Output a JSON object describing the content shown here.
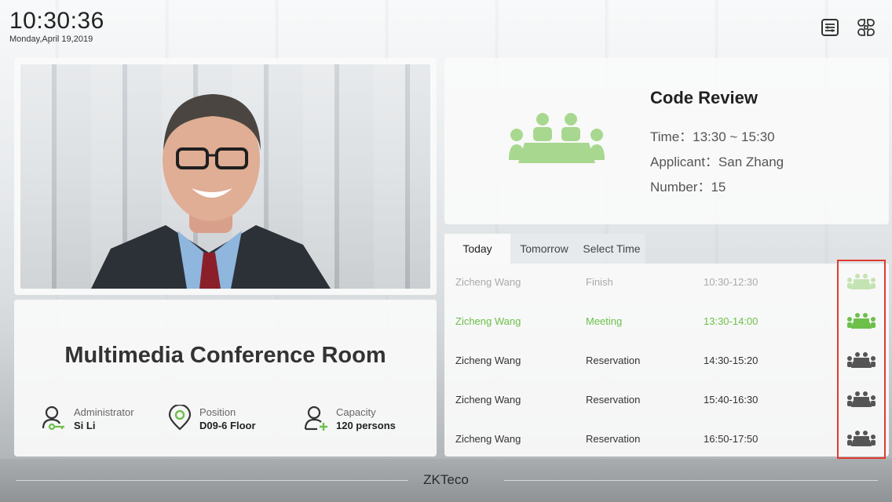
{
  "header": {
    "time": "10:30:36",
    "date": "Monday,April 19,2019",
    "icons": [
      "list-icon",
      "grid-icon"
    ]
  },
  "room": {
    "name": "Multimedia Conference Room",
    "administrator": {
      "label": "Administrator",
      "value": "Si Li",
      "icon": "admin-key-icon"
    },
    "position": {
      "label": "Position",
      "value": "D09-6 Floor",
      "icon": "location-pin-icon"
    },
    "capacity": {
      "label": "Capacity",
      "value": "120 persons",
      "icon": "person-add-icon"
    }
  },
  "meeting": {
    "title": "Code Review",
    "time": "Time：13:30 ~ 15:30",
    "applicant": "Applicant：San Zhang",
    "number": "Number：15",
    "icon": "meeting-table-icon"
  },
  "tabs": [
    {
      "label": "Today",
      "active": true
    },
    {
      "label": "Tomorrow",
      "active": false
    },
    {
      "label": "Select Time",
      "active": false
    }
  ],
  "schedule": [
    {
      "name": "Zicheng Wang",
      "status": "Finish",
      "time": "10:30-12:30",
      "state": "finish"
    },
    {
      "name": "Zicheng Wang",
      "status": "Meeting",
      "time": "13:30-14:00",
      "state": "meeting"
    },
    {
      "name": "Zicheng Wang",
      "status": "Reservation",
      "time": "14:30-15:20",
      "state": "reserve"
    },
    {
      "name": "Zicheng Wang",
      "status": "Reservation",
      "time": "15:40-16:30",
      "state": "reserve"
    },
    {
      "name": "Zicheng Wang",
      "status": "Reservation",
      "time": "16:50-17:50",
      "state": "reserve"
    }
  ],
  "colors": {
    "accent_green": "#6cc04a",
    "light_green": "#a8d88f",
    "finish_gray": "#aaaaaa",
    "reserve_dark": "#555555",
    "highlight_red": "#e03a2e"
  },
  "footer": {
    "brand": "ZKTeco"
  }
}
